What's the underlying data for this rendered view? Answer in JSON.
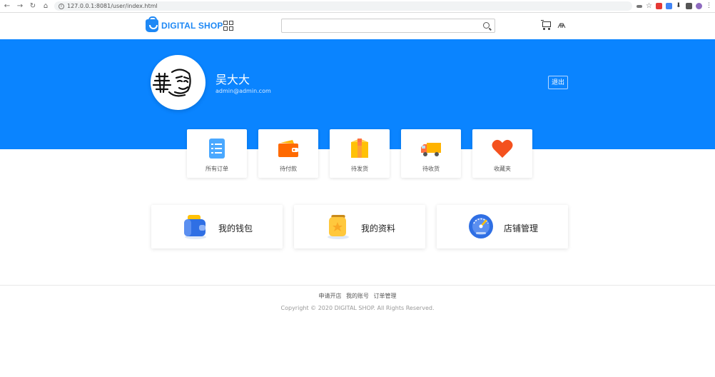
{
  "browser": {
    "url": "127.0.0.1:8081/user/index.html"
  },
  "header": {
    "logo_text": "DIGITAL SHOP",
    "search_placeholder": "",
    "brand_color": "#1e88f5"
  },
  "profile": {
    "name": "吴大大",
    "email": "admin@admin.com",
    "logout_label": "退出",
    "banner_color": "#0a84ff"
  },
  "orders": [
    {
      "label": "所有订单",
      "icon": "document-list-icon"
    },
    {
      "label": "待付款",
      "icon": "wallet-icon"
    },
    {
      "label": "待发货",
      "icon": "package-icon"
    },
    {
      "label": "待收货",
      "icon": "truck-icon"
    },
    {
      "label": "收藏夹",
      "icon": "heart-icon"
    }
  ],
  "features": [
    {
      "label": "我的钱包",
      "icon": "purse-icon"
    },
    {
      "label": "我的资料",
      "icon": "profile-card-icon"
    },
    {
      "label": "店铺管理",
      "icon": "dashboard-gauge-icon"
    }
  ],
  "footer": {
    "links": [
      "申请开店",
      "我的账号",
      "订单管理"
    ],
    "copyright": "Copyright © 2020 DIGITAL SHOP. All Rights Reserved."
  }
}
